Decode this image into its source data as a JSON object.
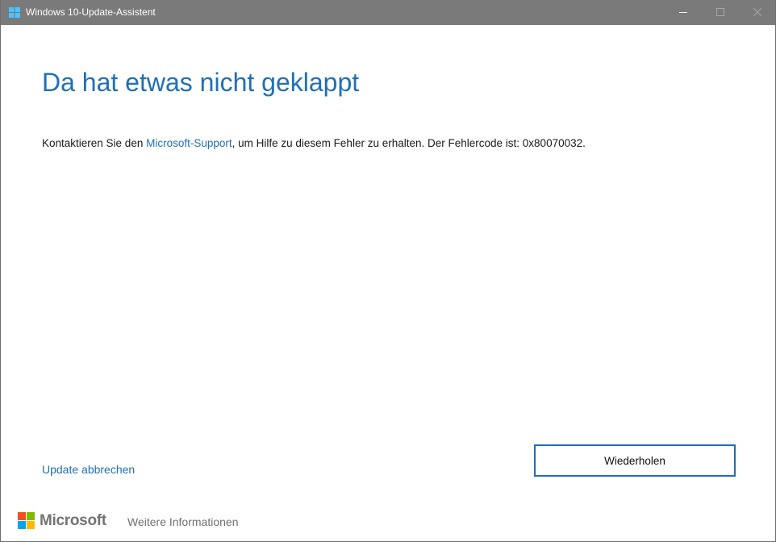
{
  "window": {
    "title": "Windows 10-Update-Assistent",
    "titlebar_color": "#7a7a7a",
    "icons": {
      "app": "windows-logo-icon",
      "minimize": "minimize-icon",
      "maximize": "maximize-icon",
      "close": "close-icon"
    }
  },
  "main": {
    "heading": "Da hat etwas nicht geklappt",
    "message": {
      "before_link": "Kontaktieren Sie den ",
      "link_text": "Microsoft-Support",
      "after_link": ", um Hilfe zu diesem Fehler zu erhalten. Der Fehlercode ist: 0x80070032."
    }
  },
  "actions": {
    "cancel_label": "Update abbrechen",
    "retry_label": "Wiederholen"
  },
  "footer": {
    "brand": "Microsoft",
    "more_info": "Weitere Informationen"
  },
  "colors": {
    "accent": "#1f6fb7",
    "logo_red": "#f25022",
    "logo_green": "#7fba00",
    "logo_blue": "#00a4ef",
    "logo_yellow": "#ffb900"
  }
}
